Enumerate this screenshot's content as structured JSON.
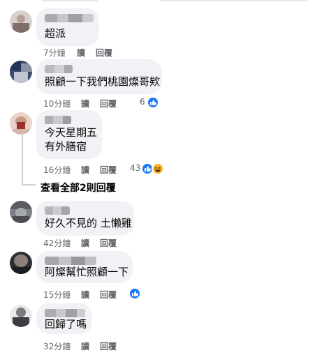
{
  "comments": [
    {
      "text": "超派",
      "time": "7分鐘",
      "reply_label": "讀",
      "respond_label": "回覆"
    },
    {
      "text": "照顧一下我們桃園燦哥欸",
      "time": "10分鐘",
      "reply_label": "讀",
      "respond_label": "回覆",
      "reaction_count": "6"
    },
    {
      "text_line1": "今天星期五",
      "text_line2": "有外膳宿",
      "time": "16分鐘",
      "reply_label": "讀",
      "respond_label": "回覆",
      "reaction_count": "43"
    },
    {
      "text": "好久不見的 土懶雞",
      "time": "42分鐘",
      "reply_label": "讀",
      "respond_label": "回覆"
    },
    {
      "text": "阿燦幫忙照顧一下",
      "time": "15分鐘",
      "reply_label": "讀",
      "respond_label": "回覆"
    },
    {
      "text": "回歸了嗎",
      "time": "32分鐘",
      "reply_label": "讀",
      "respond_label": "回覆"
    }
  ],
  "view_replies": "查看全部2則回覆",
  "icons": {
    "like": "like-reaction-icon",
    "haha": "haha-reaction-icon"
  },
  "colors": {
    "bubble": "#f0f2f5",
    "like_blue": "#1877f2",
    "meta_gray": "#65676b"
  }
}
